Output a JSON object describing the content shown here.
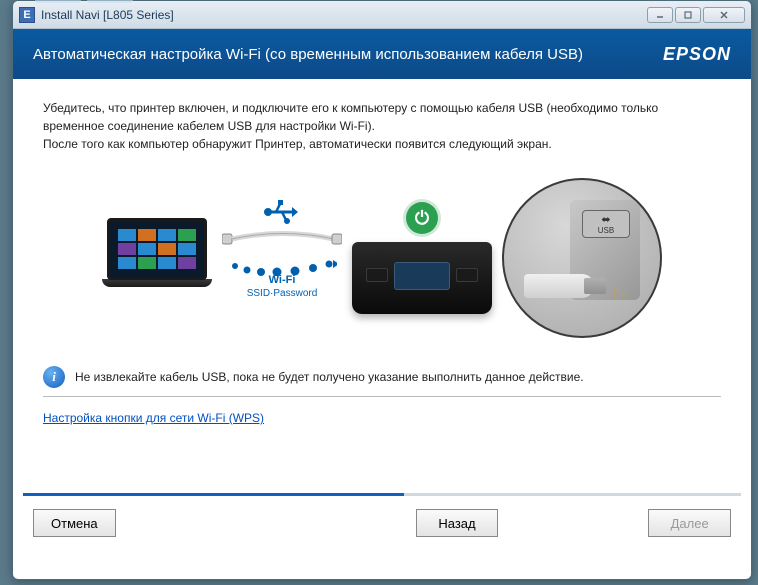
{
  "window": {
    "title": "Install Navi [L805 Series]"
  },
  "header": {
    "title": "Автоматическая настройка Wi-Fi (со временным использованием кабеля USB)",
    "brand": "EPSON"
  },
  "instructions": {
    "line1": "Убедитесь, что принтер включен, и подключите его к компьютеру с помощью кабеля USB (необходимо только временное соединение кабелем USB для настройки Wi-Fi).",
    "line2": "После того как компьютер обнаружит Принтер, автоматически появится следующий экран."
  },
  "illustration": {
    "wifi_label": "Wi-Fi",
    "wifi_sub": "SSID·Password",
    "usb_port_label": "USB"
  },
  "info": {
    "text": "Не извлекайте кабель USB, пока не будет получено указание выполнить данное действие."
  },
  "links": {
    "wps": "Настройка кнопки для сети Wi-Fi (WPS)"
  },
  "buttons": {
    "cancel": "Отмена",
    "back": "Назад",
    "next": "Далее"
  },
  "progress": {
    "percent": 53
  }
}
